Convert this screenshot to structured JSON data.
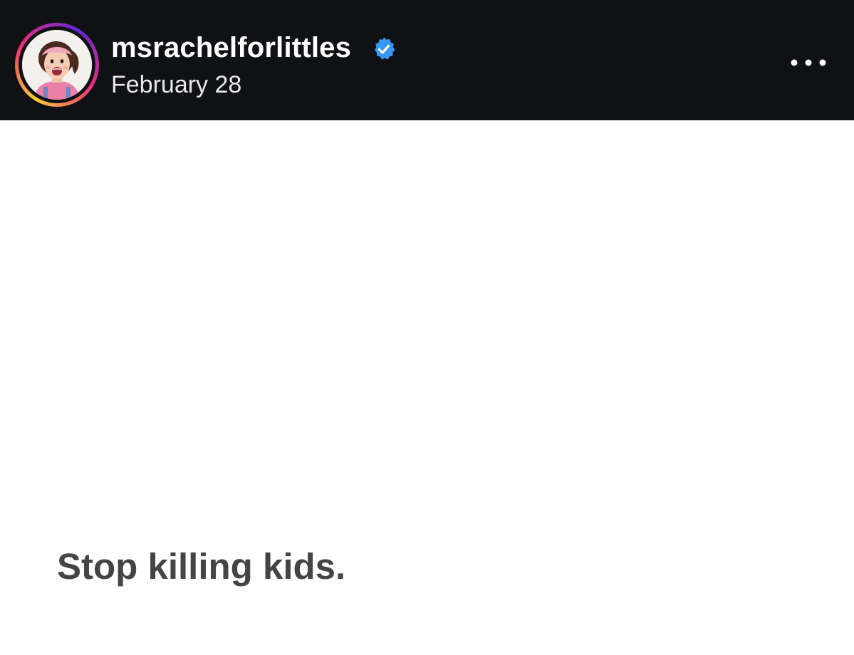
{
  "post": {
    "author": {
      "username": "msrachelforlittles",
      "verified": true,
      "avatar_icon": "profile-photo"
    },
    "date": "February 28",
    "menu_icon": "more-options-icon",
    "caption": "Stop killing kids."
  },
  "colors": {
    "header_background": "#0f1115",
    "verified_badge": "#3897f0",
    "story_ring": [
      "#f9ce34",
      "#ee2a7b",
      "#6228d7"
    ],
    "post_text": "#444444"
  }
}
